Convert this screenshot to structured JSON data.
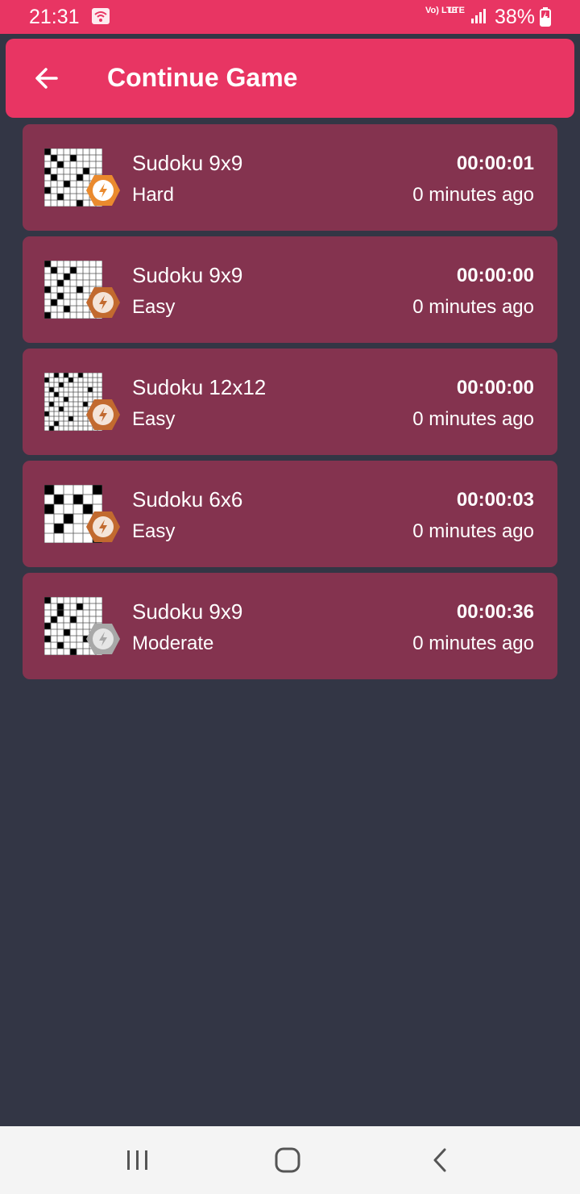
{
  "status_bar": {
    "time": "21:31",
    "volte": "Vo) LTE",
    "lte": "LTE",
    "battery": "38%",
    "icons": [
      "wifi-icon",
      "signal-icon",
      "battery-charging-icon"
    ]
  },
  "app_bar": {
    "title": "Continue Game",
    "back_icon": "arrow-left-icon",
    "color": "#e83563"
  },
  "games": [
    {
      "name": "Sudoku 9x9",
      "difficulty": "Hard",
      "time": "00:00:01",
      "ago": "0 minutes ago",
      "size": 9,
      "badge": "orange",
      "filled": [
        [
          0,
          0
        ],
        [
          1,
          1
        ],
        [
          1,
          4
        ],
        [
          2,
          2
        ],
        [
          3,
          0
        ],
        [
          3,
          6
        ],
        [
          4,
          1
        ],
        [
          4,
          5
        ],
        [
          5,
          3
        ],
        [
          6,
          0
        ],
        [
          7,
          2
        ],
        [
          8,
          5
        ]
      ]
    },
    {
      "name": "Sudoku 9x9",
      "difficulty": "Easy",
      "time": "00:00:00",
      "ago": "0 minutes ago",
      "size": 9,
      "badge": "orange-muted",
      "filled": [
        [
          0,
          0
        ],
        [
          1,
          1
        ],
        [
          1,
          4
        ],
        [
          2,
          3
        ],
        [
          3,
          2
        ],
        [
          4,
          0
        ],
        [
          4,
          5
        ],
        [
          5,
          2
        ],
        [
          6,
          1
        ],
        [
          7,
          3
        ],
        [
          8,
          0
        ]
      ]
    },
    {
      "name": "Sudoku 12x12",
      "difficulty": "Easy",
      "time": "00:00:00",
      "ago": "0 minutes ago",
      "size": 12,
      "badge": "orange-muted",
      "filled": [
        [
          0,
          2
        ],
        [
          0,
          4
        ],
        [
          0,
          7
        ],
        [
          1,
          0
        ],
        [
          1,
          5
        ],
        [
          2,
          3
        ],
        [
          3,
          1
        ],
        [
          3,
          9
        ],
        [
          4,
          2
        ],
        [
          5,
          4
        ],
        [
          6,
          1
        ],
        [
          6,
          8
        ],
        [
          7,
          3
        ],
        [
          8,
          0
        ],
        [
          9,
          5
        ],
        [
          10,
          2
        ],
        [
          11,
          1
        ]
      ]
    },
    {
      "name": "Sudoku 6x6",
      "difficulty": "Easy",
      "time": "00:00:03",
      "ago": "0 minutes ago",
      "size": 6,
      "badge": "orange-muted",
      "filled": [
        [
          0,
          0
        ],
        [
          0,
          5
        ],
        [
          1,
          1
        ],
        [
          1,
          3
        ],
        [
          2,
          0
        ],
        [
          2,
          4
        ],
        [
          3,
          2
        ],
        [
          4,
          1
        ],
        [
          5,
          5
        ]
      ]
    },
    {
      "name": "Sudoku 9x9",
      "difficulty": "Moderate",
      "time": "00:00:36",
      "ago": "0 minutes ago",
      "size": 9,
      "badge": "gray",
      "filled": [
        [
          0,
          0
        ],
        [
          1,
          2
        ],
        [
          1,
          5
        ],
        [
          2,
          2
        ],
        [
          3,
          1
        ],
        [
          3,
          4
        ],
        [
          4,
          0
        ],
        [
          5,
          3
        ],
        [
          6,
          0
        ],
        [
          6,
          6
        ],
        [
          7,
          2
        ],
        [
          8,
          4
        ]
      ]
    }
  ],
  "nav_bar": {
    "icons": [
      "recents-icon",
      "home-icon",
      "back-icon"
    ]
  },
  "colors": {
    "background": "#333645",
    "card": "#84334f",
    "accent": "#e83563",
    "badge_orange": "#ea8a2e",
    "badge_muted": "#c26a2f",
    "badge_gray": "#a8a8a8"
  }
}
